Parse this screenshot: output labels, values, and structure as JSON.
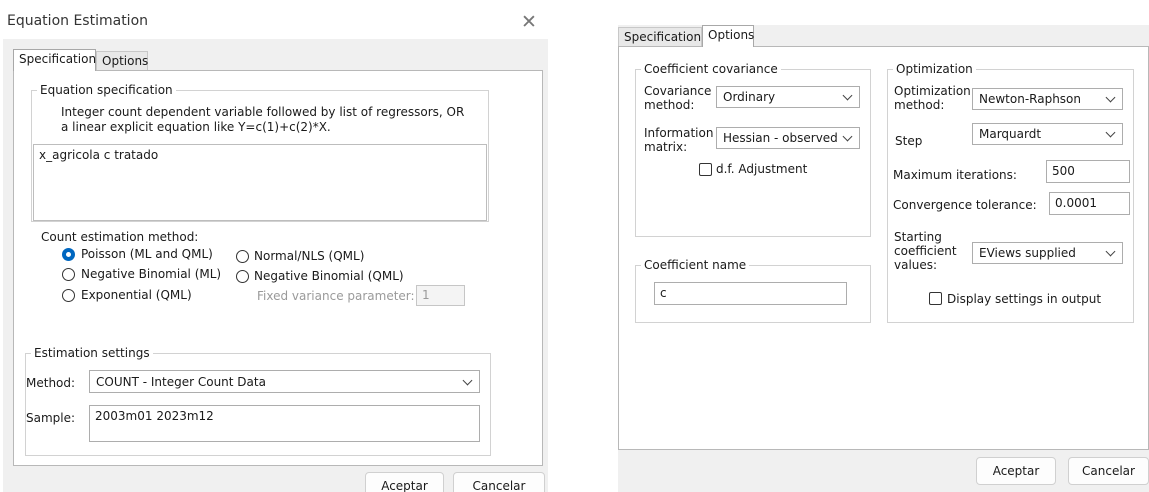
{
  "left_dialog": {
    "title": "Equation Estimation",
    "tabs": [
      "Specification",
      "Options"
    ],
    "equation_spec": {
      "group_label": "Equation specification",
      "help_line1": "Integer count dependent variable followed by list of regressors, OR",
      "help_line2": "a linear explicit equation like Y=c(1)+c(2)*X.",
      "value": "x_agricola  c tratado"
    },
    "count_method": {
      "label": "Count estimation method:",
      "options": [
        "Poisson (ML and QML)",
        "Normal/NLS (QML)",
        "Negative Binomial (ML)",
        "Negative Binomial (QML)",
        "Exponential (QML)"
      ],
      "fixed_variance_label": "Fixed variance parameter:",
      "fixed_variance_value": "1"
    },
    "estimation_settings": {
      "group_label": "Estimation settings",
      "method_label": "Method:",
      "method_value": "COUNT  -  Integer Count Data",
      "sample_label": "Sample:",
      "sample_value": "2003m01 2023m12"
    },
    "buttons": {
      "ok": "Aceptar",
      "cancel": "Cancelar"
    }
  },
  "right_dialog": {
    "tabs": [
      "Specification",
      "Options"
    ],
    "coef_cov": {
      "group_label": "Coefficient covariance",
      "cov_method_label_1": "Covariance",
      "cov_method_label_2": "method:",
      "cov_method_value": "Ordinary",
      "info_matrix_label_1": "Information",
      "info_matrix_label_2": "matrix:",
      "info_matrix_value": "Hessian - observed",
      "df_adjust": "d.f. Adjustment"
    },
    "coef_name": {
      "group_label": "Coefficient name",
      "value": "c"
    },
    "optimization": {
      "group_label": "Optimization",
      "opt_method_label_1": "Optimization",
      "opt_method_label_2": "method:",
      "opt_method_value": "Newton-Raphson",
      "step_label": "Step",
      "step_value": "Marquardt",
      "max_iter_label": "Maximum iterations:",
      "max_iter_value": "500",
      "conv_tol_label": "Convergence tolerance:",
      "conv_tol_value": "0.0001",
      "start_label_1": "Starting",
      "start_label_2": "coefficient",
      "start_label_3": "values:",
      "start_value": "EViews supplied",
      "display_settings": "Display settings in output"
    },
    "buttons": {
      "ok": "Aceptar",
      "cancel": "Cancelar"
    }
  }
}
